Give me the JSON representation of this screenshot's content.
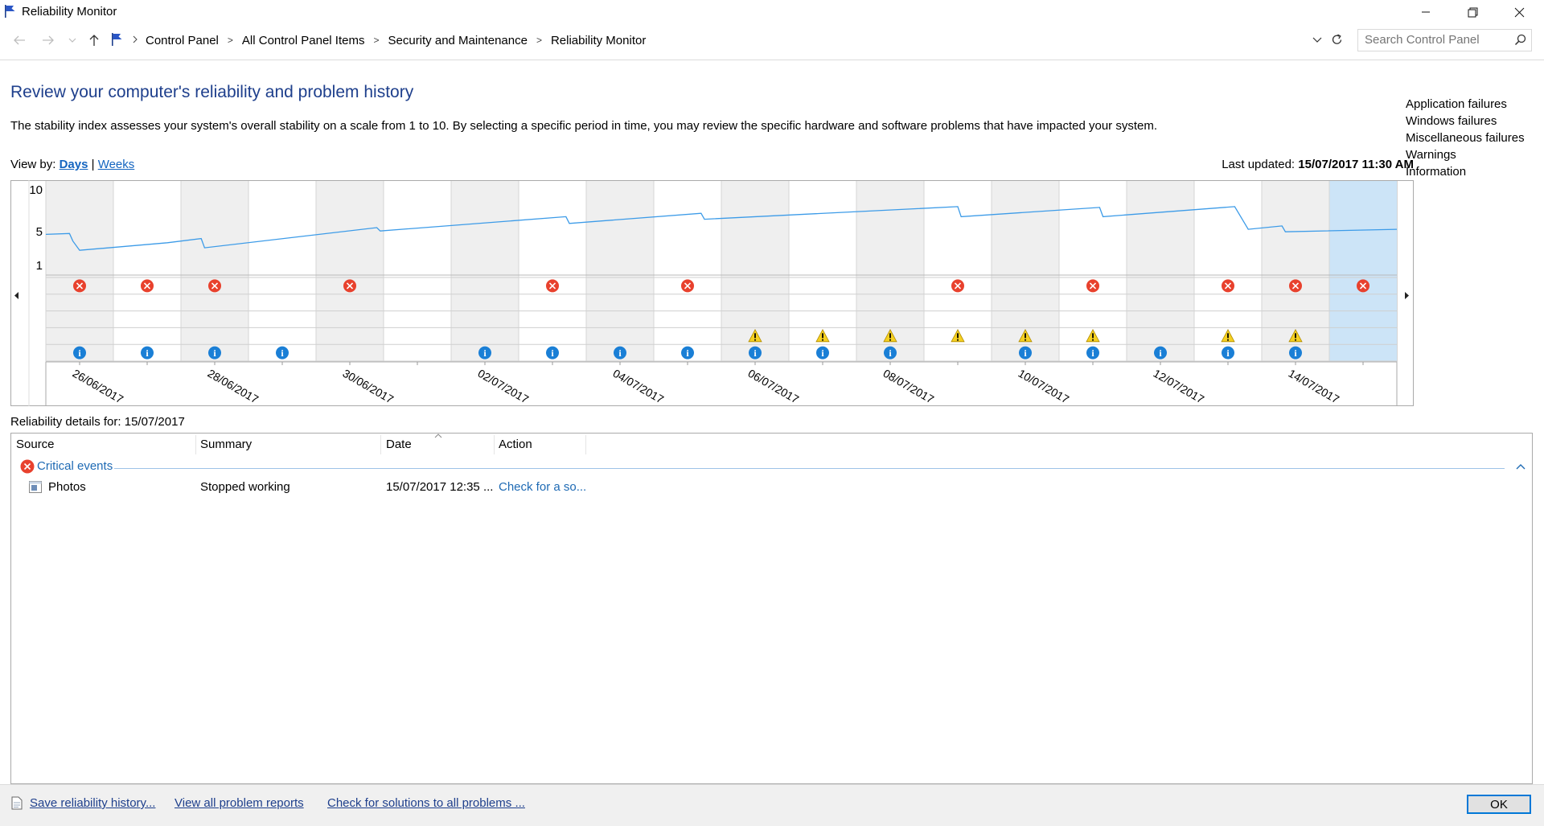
{
  "window": {
    "title": "Reliability Monitor",
    "minimize_glyph": "—",
    "maximize_glyph": "▢",
    "close_glyph": "✕"
  },
  "address": {
    "breadcrumb": [
      "Control Panel",
      "All Control Panel Items",
      "Security and Maintenance",
      "Reliability Monitor"
    ],
    "search_placeholder": "Search Control Panel"
  },
  "page": {
    "title": "Review your computer's reliability and problem history",
    "description": "The stability index assesses your system's overall stability on a scale from 1 to 10. By selecting a specific period in time, you may review the specific hardware and software problems that have impacted your system.",
    "view_by_label": "View by:",
    "view_days": "Days",
    "view_sep": "|",
    "view_weeks": "Weeks",
    "last_updated_label": "Last updated:",
    "last_updated_value": "15/07/2017 11:30 AM"
  },
  "chart_data": {
    "type": "line",
    "title": "",
    "y_ticks": [
      "10",
      "5",
      "1"
    ],
    "ylim": [
      1,
      10
    ],
    "date_labels": [
      "26/06/2017",
      "28/06/2017",
      "30/06/2017",
      "02/07/2017",
      "04/07/2017",
      "06/07/2017",
      "08/07/2017",
      "10/07/2017",
      "12/07/2017",
      "14/07/2017"
    ],
    "day_count": 20,
    "selected_day": 19,
    "stability_index": [
      [
        0,
        4.7
      ],
      [
        0.35,
        4.8
      ],
      [
        0.4,
        3.9
      ],
      [
        0.5,
        2.8
      ],
      [
        1.8,
        3.7
      ],
      [
        2.3,
        4.2
      ],
      [
        2.35,
        3.1
      ],
      [
        4.9,
        5.5
      ],
      [
        4.95,
        5.1
      ],
      [
        7.7,
        6.8
      ],
      [
        7.75,
        6.0
      ],
      [
        9.7,
        7.2
      ],
      [
        9.75,
        6.5
      ],
      [
        13.5,
        8.0
      ],
      [
        13.55,
        6.8
      ],
      [
        15.6,
        7.9
      ],
      [
        15.65,
        6.8
      ],
      [
        17.6,
        8.0
      ],
      [
        17.8,
        5.3
      ],
      [
        18.3,
        5.7
      ],
      [
        18.35,
        5.0
      ],
      [
        20,
        5.3
      ]
    ],
    "rows": [
      "Application failures",
      "Windows failures",
      "Miscellaneous failures",
      "Warnings",
      "Information"
    ],
    "events": {
      "application_failures": [
        0,
        1,
        2,
        4,
        7,
        9,
        13,
        15,
        17,
        18,
        19
      ],
      "windows_failures": [],
      "miscellaneous_failures": [],
      "warnings": [
        10,
        11,
        12,
        13,
        14,
        15,
        17,
        18
      ],
      "information": [
        0,
        1,
        2,
        3,
        6,
        7,
        8,
        9,
        10,
        11,
        12,
        14,
        15,
        16,
        17,
        18
      ]
    },
    "colors": {
      "line": "#3c9be8",
      "error": "#e8412d",
      "warning": "#f5d020",
      "info": "#1a7fd6",
      "shade": "#efefef",
      "selected": "#cce4f7"
    }
  },
  "details": {
    "label": "Reliability details for: 15/07/2017",
    "columns": [
      "Source",
      "Summary",
      "Date",
      "Action"
    ],
    "group": "Critical events",
    "rows": [
      {
        "source": "Photos",
        "summary": "Stopped working",
        "date": "15/07/2017 12:35 ...",
        "action": "Check for a so..."
      }
    ]
  },
  "footer": {
    "save_link": "Save reliability history...",
    "view_reports_link": "View all problem reports",
    "check_solutions_link": "Check for solutions to all problems ...",
    "ok_label": "OK"
  }
}
